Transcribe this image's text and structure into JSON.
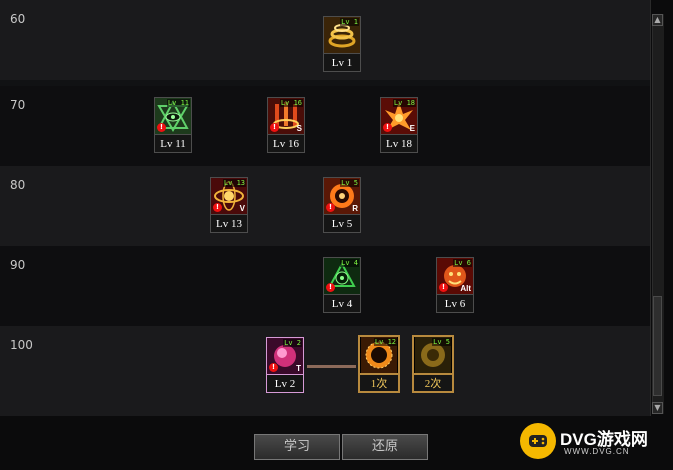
{
  "rows": [
    {
      "level": "60"
    },
    {
      "level": "70"
    },
    {
      "level": "80"
    },
    {
      "level": "90"
    },
    {
      "level": "100"
    }
  ],
  "skills": [
    {
      "badge": "Lv 1",
      "key": "",
      "label": "Lv 1"
    },
    {
      "badge": "Lv 11",
      "key": "",
      "label": "Lv 11"
    },
    {
      "badge": "Lv 16",
      "key": "S",
      "label": "Lv 16"
    },
    {
      "badge": "Lv 18",
      "key": "E",
      "label": "Lv 18"
    },
    {
      "badge": "Lv 13",
      "key": "V",
      "label": "Lv 13"
    },
    {
      "badge": "Lv 5",
      "key": "R",
      "label": "Lv 5"
    },
    {
      "badge": "Lv 4",
      "key": "",
      "label": "Lv 4"
    },
    {
      "badge": "Lv 6",
      "key": "Alt",
      "label": "Lv 6"
    },
    {
      "badge": "Lv 2",
      "key": "T",
      "label": "Lv 2"
    },
    {
      "badge": "Lv 12",
      "key": "",
      "label": "1次"
    },
    {
      "badge": "Lv 5",
      "key": "",
      "label": "2次"
    }
  ],
  "buttons": {
    "learn": "学习",
    "reset": "还原"
  },
  "logo": {
    "main": "DVG游戏网",
    "sub": "WWW.DVG.CN"
  },
  "colors": {
    "badge_text": "#7ef542",
    "selected_border": "#b88a3e",
    "logo_yellow": "#f5b800"
  }
}
